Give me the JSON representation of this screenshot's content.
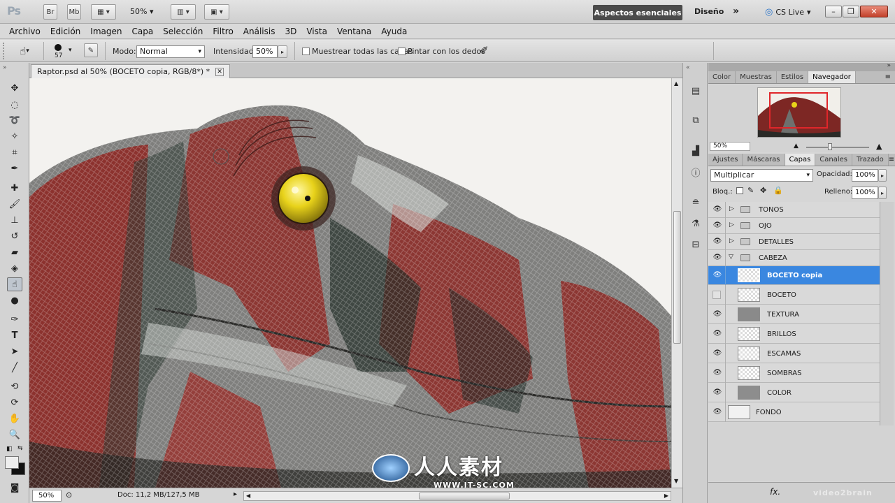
{
  "appbar": {
    "logo": "Ps",
    "buttons": [
      "Br",
      "Mb"
    ],
    "zoom": "50%",
    "workspace_active": "Aspectos esenciales",
    "workspace_other": "Diseño",
    "cs_live": "CS Live"
  },
  "menu": [
    "Archivo",
    "Edición",
    "Imagen",
    "Capa",
    "Selección",
    "Filtro",
    "Análisis",
    "3D",
    "Vista",
    "Ventana",
    "Ayuda"
  ],
  "options": {
    "brush_size": "57",
    "mode_label": "Modo:",
    "mode_value": "Normal",
    "intensity_label": "Intensidad:",
    "intensity_value": "50%",
    "sample_all_label": "Muestrear todas las capas",
    "finger_paint_label": "Pintar con los dedos"
  },
  "document": {
    "tab_title": "Raptor.psd al 50% (BOCETO copia, RGB/8*) *",
    "status_zoom": "50%",
    "status_doc": "Doc: 11,2 MB/127,5 MB"
  },
  "navigator_panel": {
    "tabs": [
      "Color",
      "Muestras",
      "Estilos",
      "Navegador"
    ],
    "active_tab": "Navegador",
    "zoom": "50%"
  },
  "layers_panel": {
    "tabs": [
      "Ajustes",
      "Máscaras",
      "Capas",
      "Canales",
      "Trazado"
    ],
    "active_tab": "Capas",
    "blend_mode": "Multiplicar",
    "opacity_label": "Opacidad:",
    "opacity_value": "100%",
    "lock_label": "Bloq.:",
    "fill_label": "Relleno:",
    "fill_value": "100%",
    "layers": [
      {
        "name": "TONOS",
        "type": "group",
        "visible": true
      },
      {
        "name": "OJO",
        "type": "group",
        "visible": true
      },
      {
        "name": "DETALLES",
        "type": "group",
        "visible": true
      },
      {
        "name": "CABEZA",
        "type": "group-open",
        "visible": true
      },
      {
        "name": "BOCETO copia",
        "type": "layer",
        "visible": true,
        "selected": true
      },
      {
        "name": "BOCETO",
        "type": "layer",
        "visible": false
      },
      {
        "name": "TEXTURA",
        "type": "layer",
        "visible": true
      },
      {
        "name": "BRILLOS",
        "type": "layer",
        "visible": true
      },
      {
        "name": "ESCAMAS",
        "type": "layer",
        "visible": true
      },
      {
        "name": "SOMBRAS",
        "type": "layer",
        "visible": true
      },
      {
        "name": "COLOR",
        "type": "layer",
        "visible": true
      },
      {
        "name": "FONDO",
        "type": "background",
        "visible": true
      }
    ],
    "footer_fx": "fx."
  },
  "watermark": {
    "logo_text": "人人素材",
    "url": "WWW.IT-SC.COM",
    "site": "video2brain"
  },
  "colors": {
    "selection": "#3a87e0",
    "workspace_active_bg": "#4b4b4b",
    "raptor_red": "#8e2a26",
    "raptor_gray": "#8a8d8c",
    "eye_yellow": "#e8d21a"
  }
}
